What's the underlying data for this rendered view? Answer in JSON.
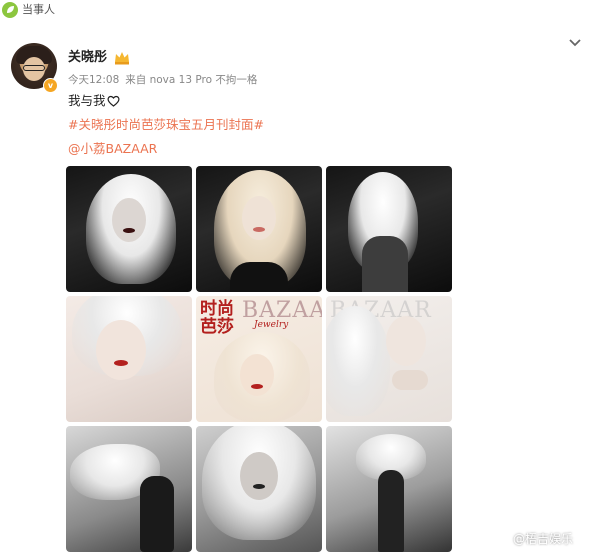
{
  "header": {
    "label": "当事人"
  },
  "post": {
    "author": "关晓彤",
    "time": "今天12:08",
    "source": "来自 nova 13 Pro 不拘一格",
    "text": "我与我",
    "hashtag": "#关晓彤时尚芭莎珠宝五月刊封面#",
    "mention": "@小荔BAZAAR",
    "cover_text": {
      "cn": "时尚芭莎",
      "en": "BAZAAR",
      "sub": "Jewelry"
    }
  },
  "watermark": "@梧吉娱乐",
  "colors": {
    "accent": "#eb7350",
    "badge": "#f5a623",
    "lips": "#b3201e"
  },
  "icons": [
    "leaf-icon",
    "chevron-down-icon",
    "crown-icon",
    "verified-badge-icon",
    "heart-icon"
  ]
}
